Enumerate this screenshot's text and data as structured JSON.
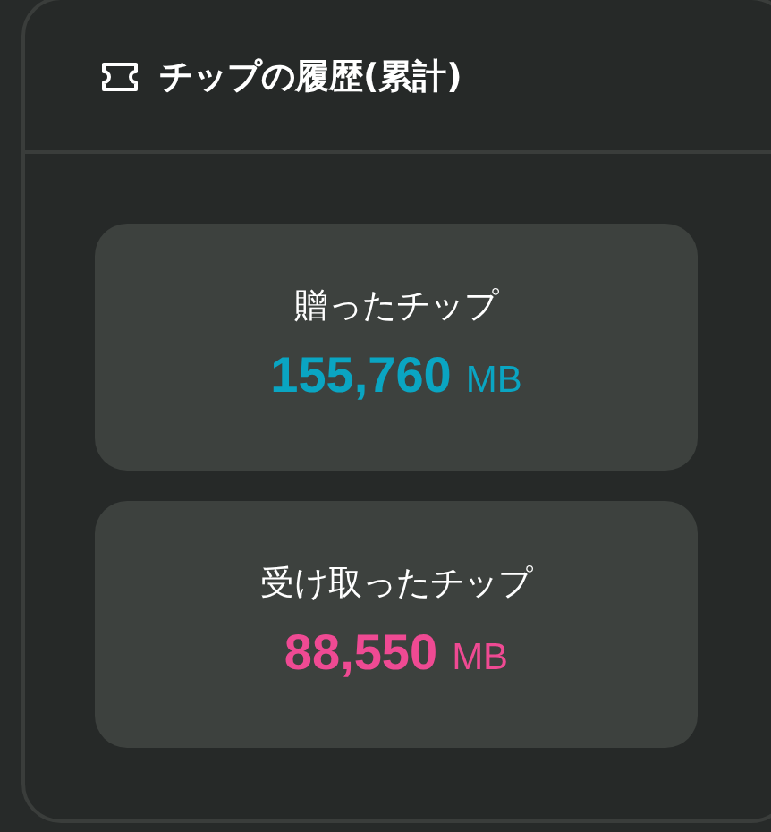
{
  "panel": {
    "title": "チップの履歴(累計)"
  },
  "stats": [
    {
      "label": "贈ったチップ",
      "value": "155,760",
      "unit": "MB",
      "color": "#0aa5c2"
    },
    {
      "label": "受け取ったチップ",
      "value": "88,550",
      "unit": "MB",
      "color": "#ef4a93"
    }
  ]
}
